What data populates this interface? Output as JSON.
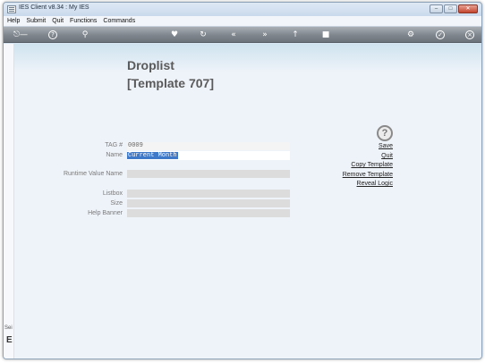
{
  "window": {
    "title": "IES Client v8.34 : My IES"
  },
  "menu": [
    "Help",
    "Submit",
    "Quit",
    "Functions",
    "Commands"
  ],
  "toolbar": {
    "icons": [
      "key-icon",
      "help-icon",
      "search-icon",
      "heart-icon",
      "refresh-icon",
      "rewind-icon",
      "fast-forward-icon",
      "pin-icon",
      "stop-icon",
      "gear-icon",
      "check-icon",
      "close-icon"
    ]
  },
  "page": {
    "title": "Droplist",
    "subtitle": "[Template 707]"
  },
  "form": {
    "tag_label": "TAG #",
    "tag_value": "0009",
    "name_label": "Name",
    "name_value": "Current Month",
    "runtime_label": "Runtime Value Name",
    "listbox_label": "Listbox",
    "size_label": "Size",
    "help_banner_label": "Help Banner"
  },
  "actions": {
    "help_glyph": "?",
    "save": "Save",
    "quit": "Quit",
    "copy_template": "Copy Template",
    "remove_template": "Remove Template",
    "reveal_logic": "Reveal Logic"
  },
  "rail": {
    "text1": "Sei",
    "text2": "E"
  }
}
